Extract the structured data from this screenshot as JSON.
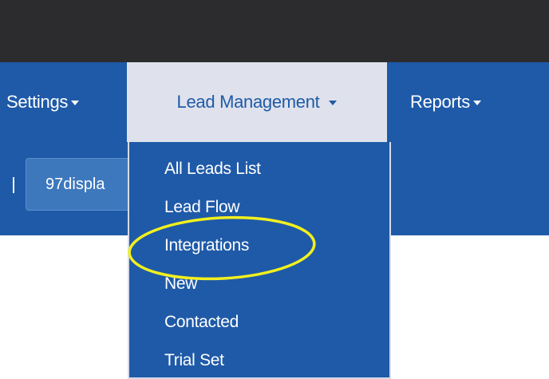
{
  "nav": {
    "settings_label": "Settings",
    "lead_management_label": "Lead Management",
    "reports_label": "Reports"
  },
  "toolbar": {
    "separator": "|",
    "display_button_label": "97displa"
  },
  "dropdown": {
    "items": [
      {
        "label": "All Leads List"
      },
      {
        "label": "Lead Flow"
      },
      {
        "label": "Integrations"
      },
      {
        "label": "New"
      },
      {
        "label": "Contacted"
      },
      {
        "label": "Trial Set"
      }
    ]
  },
  "colors": {
    "nav_background": "#1f5aa8",
    "topbar_background": "#2c2c2e",
    "active_tab_background": "#dfe2ec",
    "highlight_ellipse": "#f2f01e"
  }
}
